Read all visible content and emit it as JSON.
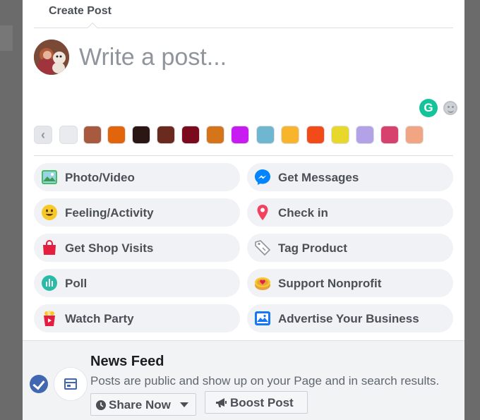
{
  "header": {
    "title": "Create Post"
  },
  "composer": {
    "placeholder": "Write a post..."
  },
  "grammarly": {
    "icon": "grammarly-icon",
    "glyph": "G",
    "color": "#15c39a"
  },
  "emoji": {
    "icon": "emoji-icon"
  },
  "backgrounds": {
    "back_glyph": "‹",
    "swatches": [
      {
        "name": "plain",
        "color": "#e9ebee"
      },
      {
        "name": "brown",
        "color": "#a85a3f"
      },
      {
        "name": "orange-leaves",
        "color": "#e2650c"
      },
      {
        "name": "dark-brown",
        "color": "#2a1714"
      },
      {
        "name": "dark-floral",
        "color": "#6b2a1e"
      },
      {
        "name": "red-floral",
        "color": "#7b0a1c"
      },
      {
        "name": "autumn",
        "color": "#d6741a"
      },
      {
        "name": "purple",
        "color": "#c81bf2"
      },
      {
        "name": "teal",
        "color": "#6fb6d0"
      },
      {
        "name": "yellow-orange",
        "color": "#f8b52b"
      },
      {
        "name": "red-orange",
        "color": "#f24b17"
      },
      {
        "name": "yellow",
        "color": "#e8d82b"
      },
      {
        "name": "lavender",
        "color": "#b3a2e8"
      },
      {
        "name": "pink-pattern",
        "color": "#d6416e"
      },
      {
        "name": "peach",
        "color": "#f2a582"
      }
    ]
  },
  "actions": {
    "photo_video": "Photo/Video",
    "get_messages": "Get Messages",
    "feeling_activity": "Feeling/Activity",
    "check_in": "Check in",
    "get_shop_visits": "Get Shop Visits",
    "tag_product": "Tag Product",
    "poll": "Poll",
    "support_nonprofit": "Support Nonprofit",
    "watch_party": "Watch Party",
    "advertise_business": "Advertise Your Business"
  },
  "footer": {
    "title": "News Feed",
    "description": "Posts are public and show up on your Page and in search results.",
    "share_now": "Share Now",
    "boost_post": "Boost Post"
  },
  "colors": {
    "accent": "#4267b2",
    "messenger": "#0084ff"
  }
}
